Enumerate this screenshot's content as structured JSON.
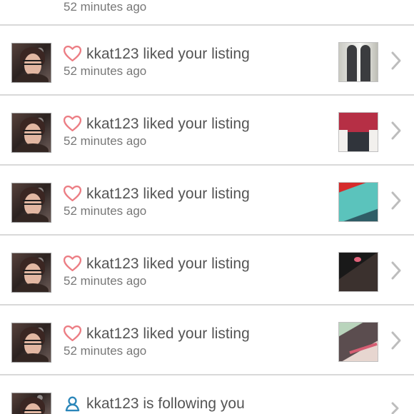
{
  "notifications": [
    {
      "time": "52 minutes ago",
      "partial": true
    },
    {
      "text": "kkat123 liked your listing",
      "time": "52 minutes ago",
      "icon": "heart-icon",
      "thumbnail": "pants-thumbnail"
    },
    {
      "text": "kkat123 liked your listing",
      "time": "52 minutes ago",
      "icon": "heart-icon",
      "thumbnail": "shirt-thumbnail"
    },
    {
      "text": "kkat123 liked your listing",
      "time": "52 minutes ago",
      "icon": "heart-icon",
      "thumbnail": "teal-shirt-thumbnail"
    },
    {
      "text": "kkat123 liked your listing",
      "time": "52 minutes ago",
      "icon": "heart-icon",
      "thumbnail": "dark-shorts-thumbnail"
    },
    {
      "text": "kkat123 liked your listing",
      "time": "52 minutes ago",
      "icon": "heart-icon",
      "thumbnail": "shorts-thumbnail"
    },
    {
      "text": "kkat123 is following you",
      "icon": "user-icon",
      "partial": true
    }
  ],
  "colors": {
    "heart": "#ec7d84",
    "follow": "#2b86b9",
    "primary_text": "#555555",
    "secondary_text": "#777777",
    "divider": "#d9d9d9",
    "chevron": "#bdbdbd"
  }
}
